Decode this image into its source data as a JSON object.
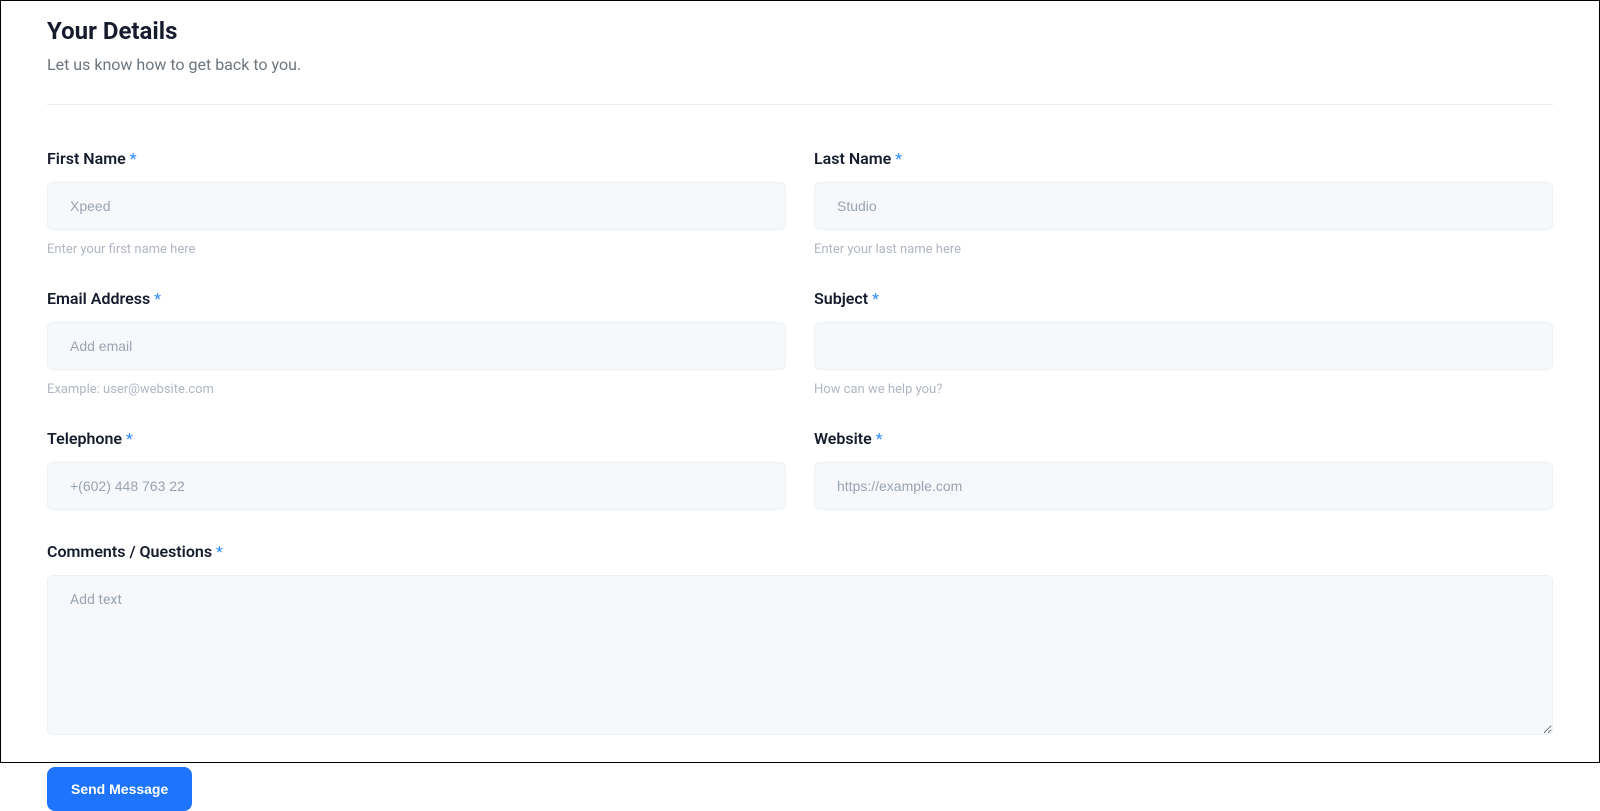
{
  "header": {
    "title": "Your Details",
    "subtitle": "Let us know how to get back to you."
  },
  "fields": {
    "firstName": {
      "label": "First Name",
      "required": "*",
      "placeholder": "Xpeed",
      "hint": "Enter your first name here"
    },
    "lastName": {
      "label": "Last Name",
      "required": "*",
      "placeholder": "Studio",
      "hint": "Enter your last name here"
    },
    "email": {
      "label": "Email Address",
      "required": "*",
      "placeholder": "Add email",
      "hint": "Example: user@website.com"
    },
    "subject": {
      "label": "Subject",
      "required": "*",
      "placeholder": "",
      "hint": "How can we help you?"
    },
    "telephone": {
      "label": "Telephone",
      "required": "*",
      "placeholder": "+(602) 448 763 22"
    },
    "website": {
      "label": "Website",
      "required": "*",
      "placeholder": "https://example.com"
    },
    "comments": {
      "label": "Comments / Questions",
      "required": "*",
      "placeholder": "Add text"
    }
  },
  "submit": {
    "label": "Send Message"
  }
}
